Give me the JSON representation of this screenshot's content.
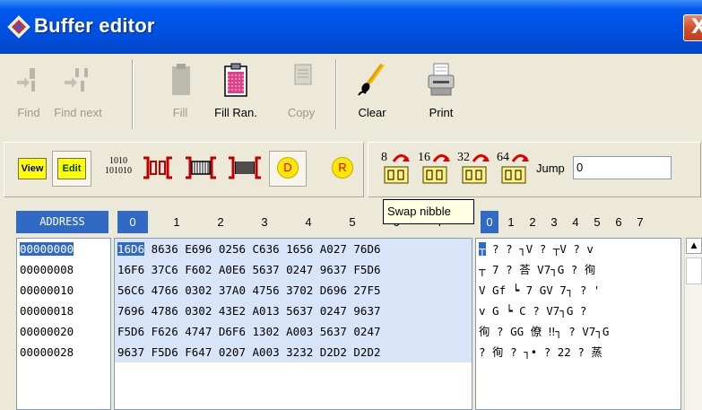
{
  "window": {
    "title": "Buffer editor",
    "close_label": "X"
  },
  "toolbar": {
    "find_label": "Find",
    "find_next_label": "Find next",
    "fill_label": "Fill",
    "fill_random_label": "Fill Ran.",
    "copy_label": "Copy",
    "clear_label": "Clear",
    "print_label": "Print"
  },
  "mode_toolbar": {
    "view_label": "View",
    "edit_label": "Edit",
    "bits_line1": "1010",
    "bits_line2": "101010",
    "d_label": "D",
    "r_label": "R",
    "swap_labels": [
      "8",
      "16",
      "32",
      "64"
    ],
    "jump_label": "Jump",
    "jump_value": "0",
    "tooltip": "Swap nibble"
  },
  "header": {
    "address_label": "ADDRESS",
    "hex_columns": [
      "0",
      "1",
      "2",
      "3",
      "4",
      "5",
      "6",
      "7"
    ],
    "text_columns": [
      "0",
      "1",
      "2",
      "3",
      "4",
      "5",
      "6",
      "7"
    ]
  },
  "rows": [
    {
      "address": "00000000",
      "hex_first": "16D6",
      "hex_rest": " 8636 E696 0256 C636 1656 A027 76D6",
      "text_first": "┬",
      "text_rest": " ?  ?  ┐V ?  ┬V ?  v"
    },
    {
      "address": "00000008",
      "hex": "16F6 37C6 F602 A0E6 5637 0247 9637 F5D6",
      "text": "┬  7  ?  荅 V7┐G ?  徇"
    },
    {
      "address": "00000010",
      "hex": "56C6 4766 0302 37A0 4756 3702 D696 27F5",
      "text": "V  Gf ┕ 7  GV 7┐ ?  '"
    },
    {
      "address": "00000018",
      "hex": "7696 4786 0302 43E2 A013 5637 0247 9637",
      "text": "v  G  ┕ C  ?  V7┐G ?"
    },
    {
      "address": "00000020",
      "hex": "F5D6 F626 4747 D6F6 1302 A003 5637 0247",
      "text": "徇 ?  GG 僚 ‼┐ ?  V7┐G"
    },
    {
      "address": "00000028",
      "hex": "9637 F5D6 F647 0207 A003 3232 D2D2 D2D2",
      "text": "?  徇 ?  ┐• ?  22 ?  蒸"
    }
  ],
  "colors": {
    "selection": "#316AC5",
    "hex_background": "#D8E4F8",
    "titlebar": "#0054E3"
  }
}
